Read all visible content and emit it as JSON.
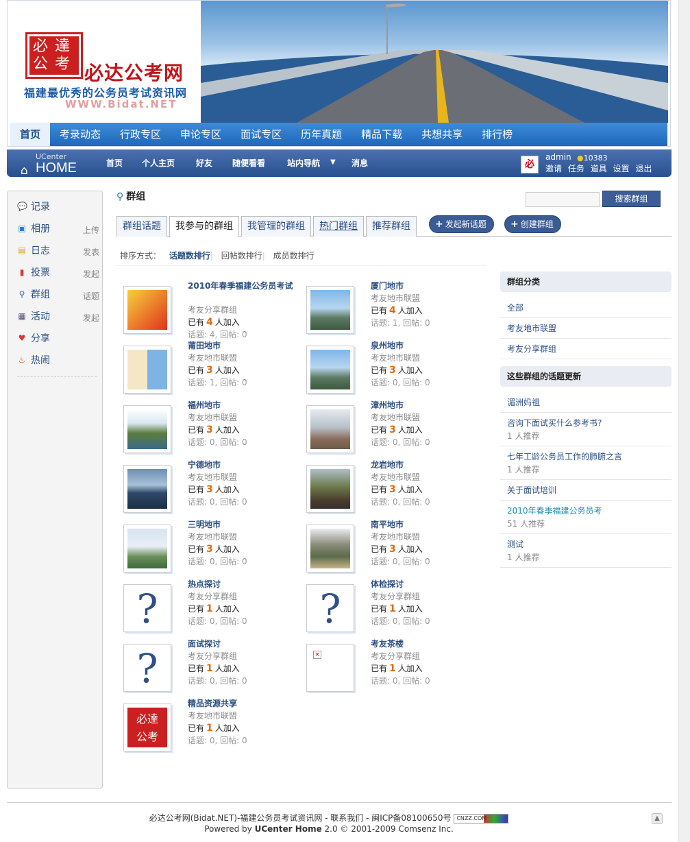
{
  "banner": {
    "seal": [
      "必",
      "達",
      "公",
      "考"
    ],
    "brand": "必达公考网",
    "slogan": "福建最优秀的公务员考试资讯网",
    "domain": "WWW.Bidat.NET",
    "nav": [
      "首页",
      "考录动态",
      "行政专区",
      "申论专区",
      "面试专区",
      "历年真题",
      "精品下载",
      "共想共享",
      "排行榜"
    ]
  },
  "topbar": {
    "logo_small": "UCenter",
    "logo_big": "HOME",
    "nav": [
      "首页",
      "个人主页",
      "好友",
      "随便看看",
      "站内导航",
      "消息"
    ],
    "username": "admin",
    "credit": "10383",
    "user_links": [
      "邀请",
      "任务",
      "道具",
      "设置",
      "退出"
    ],
    "avatar_text": "必"
  },
  "sidebar": [
    {
      "label": "记录",
      "icon": "chat-bubble-icon",
      "action": ""
    },
    {
      "label": "相册",
      "icon": "photo-icon",
      "action": "上传"
    },
    {
      "label": "日志",
      "icon": "notebook-icon",
      "action": "发表"
    },
    {
      "label": "投票",
      "icon": "bar-chart-icon",
      "action": "发起"
    },
    {
      "label": "群组",
      "icon": "group-icon",
      "action": "话题"
    },
    {
      "label": "活动",
      "icon": "calendar-icon",
      "action": "发起"
    },
    {
      "label": "分享",
      "icon": "hearts-icon",
      "action": ""
    },
    {
      "label": "热闹",
      "icon": "fire-icon",
      "action": ""
    }
  ],
  "page": {
    "title": "群组",
    "search_button": "搜索群组",
    "tabs": [
      "群组话题",
      "我参与的群组",
      "我管理的群组",
      "热门群组",
      "推荐群组"
    ],
    "new_topic": "发起新话题",
    "create_group": "创建群组",
    "sort_label": "排序方式：",
    "sort_options": [
      "话题数排行",
      "回帖数排行",
      "成员数排行"
    ]
  },
  "groups": [
    {
      "name": "2010年春季福建公务员考试",
      "category": "考友分享群组",
      "join_pre": "已有",
      "count": "4",
      "join_post": "人加入",
      "stats": "话题: 4, 回帖: 0",
      "thumb": "promo"
    },
    {
      "name": "厦门地市",
      "category": "考友地市联盟",
      "join_pre": "已有",
      "count": "4",
      "join_post": "人加入",
      "stats": "话题: 1, 回帖: 0",
      "thumb": "city"
    },
    {
      "name": "莆田地市",
      "category": "考友地市联盟",
      "join_pre": "已有",
      "count": "3",
      "join_post": "人加入",
      "stats": "话题: 1, 回帖: 0",
      "thumb": "book"
    },
    {
      "name": "泉州地市",
      "category": "考友地市联盟",
      "join_pre": "已有",
      "count": "3",
      "join_post": "人加入",
      "stats": "话题: 0, 回帖: 0",
      "thumb": "city"
    },
    {
      "name": "福州地市",
      "category": "考友地市联盟",
      "join_pre": "已有",
      "count": "3",
      "join_post": "人加入",
      "stats": "话题: 0, 回帖: 0",
      "thumb": "park"
    },
    {
      "name": "漳州地市",
      "category": "考友地市联盟",
      "join_pre": "已有",
      "count": "3",
      "join_post": "人加入",
      "stats": "话题: 0, 回帖: 0",
      "thumb": "city2"
    },
    {
      "name": "宁德地市",
      "category": "考友地市联盟",
      "join_pre": "已有",
      "count": "3",
      "join_post": "人加入",
      "stats": "话题: 0, 回帖: 0",
      "thumb": "bay"
    },
    {
      "name": "龙岩地市",
      "category": "考友地市联盟",
      "join_pre": "已有",
      "count": "3",
      "join_post": "人加入",
      "stats": "话题: 0, 回帖: 0",
      "thumb": "hill"
    },
    {
      "name": "三明地市",
      "category": "考友地市联盟",
      "join_pre": "已有",
      "count": "3",
      "join_post": "人加入",
      "stats": "话题: 0, 回帖: 0",
      "thumb": "building"
    },
    {
      "name": "南平地市",
      "category": "考友地市联盟",
      "join_pre": "已有",
      "count": "3",
      "join_post": "人加入",
      "stats": "话题: 0, 回帖: 0",
      "thumb": "valley"
    },
    {
      "name": "热点探讨",
      "category": "考友分享群组",
      "join_pre": "已有",
      "count": "1",
      "join_post": "人加入",
      "stats": "话题: 0, 回帖: 0",
      "thumb": "question"
    },
    {
      "name": "体检探讨",
      "category": "考友分享群组",
      "join_pre": "已有",
      "count": "1",
      "join_post": "人加入",
      "stats": "话题: 0, 回帖: 0",
      "thumb": "question"
    },
    {
      "name": "面试探讨",
      "category": "考友分享群组",
      "join_pre": "已有",
      "count": "1",
      "join_post": "人加入",
      "stats": "话题: 0, 回帖: 0",
      "thumb": "question"
    },
    {
      "name": "考友茶楼",
      "category": "考友分享群组",
      "join_pre": "已有",
      "count": "1",
      "join_post": "人加入",
      "stats": "话题: 0, 回帖: 0",
      "thumb": "broken"
    },
    {
      "name": "精品资源共享",
      "category": "考友地市联盟",
      "join_pre": "已有",
      "count": "1",
      "join_post": "人加入",
      "stats": "话题: 0, 回帖: 0",
      "thumb": "seal"
    }
  ],
  "right": {
    "cat_title": "群组分类",
    "categories": [
      "全部",
      "考友地市联盟",
      "考友分享群组"
    ],
    "updates_title": "这些群组的话题更新",
    "updates": [
      {
        "title": "湄洲妈祖",
        "sub": ""
      },
      {
        "title": "咨询下面试买什么参考书?",
        "sub": "1 人推荐"
      },
      {
        "title": "七年工龄公务员工作的肺腑之言",
        "sub": "1 人推荐"
      },
      {
        "title": "关于面试培训",
        "sub": ""
      },
      {
        "title": "2010年春季福建公务员考",
        "sub": "51 人推荐"
      },
      {
        "title": "测试",
        "sub": "1 人推荐"
      }
    ]
  },
  "footer": {
    "line1": "必达公考网(Bidat.NET)-福建公务员考试资讯网 - 联系我们 - 闽ICP备08100650号",
    "cnzz": "CNZZ.COM",
    "line2_pre": "Powered by ",
    "line2_brand": "UCenter Home",
    "line2_post": " 2.0 © 2001-2009 Comsenz Inc."
  },
  "colors": {
    "nav_blue": "#1f67ba",
    "topbar": "#3a5b94",
    "accent_orange": "#e06a0c",
    "link": "#2c4f82"
  }
}
